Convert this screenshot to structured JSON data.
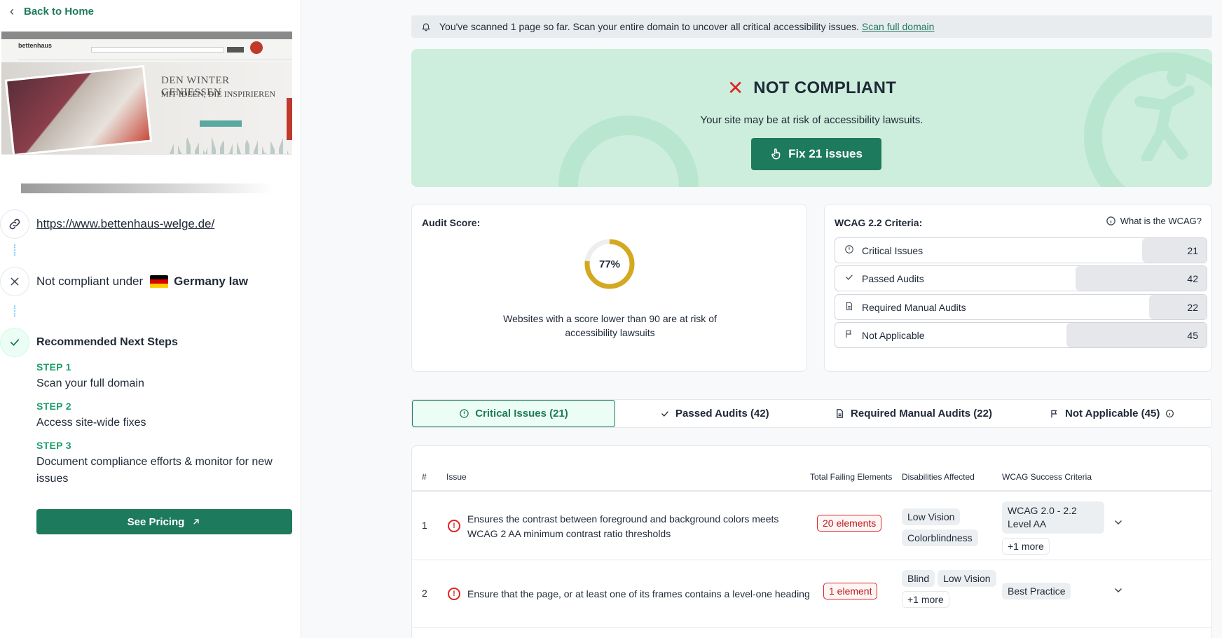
{
  "sidebar": {
    "back_label": "Back to Home",
    "preview": {
      "logo_text": "bettenhaus",
      "headline_1": "DEN WINTER GENIESSEN",
      "headline_2": "MIT IDEEN, DIE INSPIRIEREN"
    },
    "url": "https://www.bettenhaus-welge.de/",
    "compliance_prefix": "Not compliant under",
    "compliance_law": "Germany law",
    "flag_colors": [
      "#000000",
      "#dd0000",
      "#ffce00"
    ],
    "steps_title": "Recommended Next Steps",
    "steps": [
      {
        "label": "STEP 1",
        "text": "Scan your full domain"
      },
      {
        "label": "STEP 2",
        "text": "Access site-wide fixes"
      },
      {
        "label": "STEP 3",
        "text": "Document compliance efforts & monitor for new issues"
      }
    ],
    "pricing_label": "See Pricing"
  },
  "banner": {
    "text": "You've scanned 1 page so far. Scan your entire domain to uncover all critical accessibility issues.",
    "link": "Scan full domain"
  },
  "hero": {
    "title": "NOT COMPLIANT",
    "subtitle": "Your site may be at risk of accessibility lawsuits.",
    "fix_label": "Fix 21 issues"
  },
  "audit": {
    "title": "Audit Score:",
    "score": 77,
    "score_label": "77%",
    "note": "Websites with a score lower than 90 are at risk of accessibility lawsuits",
    "ring_color": "#d4a820"
  },
  "wcag": {
    "title": "WCAG 2.2 Criteria:",
    "help": "What is the WCAG?",
    "rows": [
      {
        "icon": "alert-circle-icon",
        "label": "Critical Issues",
        "count": "21"
      },
      {
        "icon": "check-icon",
        "label": "Passed Audits",
        "count": "42"
      },
      {
        "icon": "document-icon",
        "label": "Required Manual Audits",
        "count": "22"
      },
      {
        "icon": "flag-icon",
        "label": "Not Applicable",
        "count": "45"
      }
    ]
  },
  "tabs": [
    {
      "label": "Critical Issues (21)"
    },
    {
      "label": "Passed Audits (42)"
    },
    {
      "label": "Required Manual Audits (22)"
    },
    {
      "label": "Not Applicable (45)"
    }
  ],
  "table": {
    "headers": {
      "num": "#",
      "issue": "Issue",
      "failing": "Total Failing Elements",
      "disabilities": "Disabilities Affected",
      "criteria": "WCAG Success Criteria"
    },
    "rows": [
      {
        "num": "1",
        "issue": "Ensures the contrast between foreground and background colors meets WCAG 2 AA minimum contrast ratio thresholds",
        "elements": "20 elements",
        "disabilities": [
          "Low Vision",
          "Colorblindness"
        ],
        "criteria": "WCAG 2.0 - 2.2 Level AA",
        "criteria_more": "+1 more"
      },
      {
        "num": "2",
        "issue": "Ensure that the page, or at least one of its frames contains a level-one heading",
        "elements": "1 element",
        "disabilities": [
          "Blind",
          "Low Vision"
        ],
        "disabilities_more": "+1 more",
        "criteria": "Best Practice"
      }
    ]
  }
}
